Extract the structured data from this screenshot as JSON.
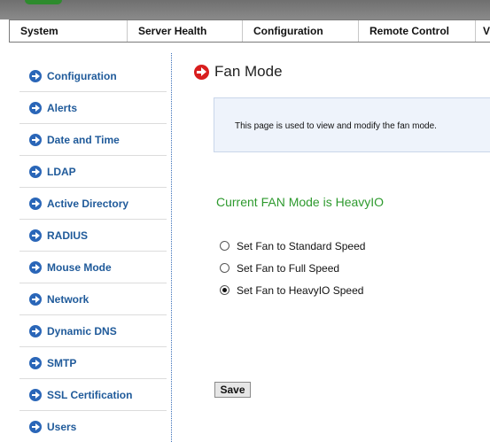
{
  "nav": {
    "items": [
      "System",
      "Server Health",
      "Configuration",
      "Remote Control",
      "V"
    ]
  },
  "sidebar": {
    "items": [
      {
        "label": "Configuration",
        "icon": "arrow-right-circle-icon"
      },
      {
        "label": "Alerts",
        "icon": "arrow-right-circle-icon"
      },
      {
        "label": "Date and Time",
        "icon": "arrow-right-circle-icon"
      },
      {
        "label": "LDAP",
        "icon": "arrow-right-circle-icon"
      },
      {
        "label": "Active Directory",
        "icon": "arrow-right-circle-icon"
      },
      {
        "label": "RADIUS",
        "icon": "arrow-right-circle-icon"
      },
      {
        "label": "Mouse Mode",
        "icon": "arrow-right-circle-icon"
      },
      {
        "label": "Network",
        "icon": "arrow-right-circle-icon"
      },
      {
        "label": "Dynamic DNS",
        "icon": "arrow-right-circle-icon"
      },
      {
        "label": "SMTP",
        "icon": "arrow-right-circle-icon"
      },
      {
        "label": "SSL Certification",
        "icon": "arrow-right-circle-icon"
      },
      {
        "label": "Users",
        "icon": "arrow-right-circle-icon"
      }
    ]
  },
  "page": {
    "title": "Fan Mode",
    "description": "This page is used to view and modify the fan mode.",
    "current_mode": "Current FAN Mode is HeavyIO",
    "options": [
      {
        "label": "Set Fan to Standard Speed",
        "checked": false
      },
      {
        "label": "Set Fan to Full Speed",
        "checked": false
      },
      {
        "label": "Set Fan to HeavyIO Speed",
        "checked": true
      }
    ],
    "save_label": "Save"
  },
  "colors": {
    "accent": "#2a66b8",
    "status_green": "#2e9a2e",
    "title_arrow": "#d81e1e"
  }
}
